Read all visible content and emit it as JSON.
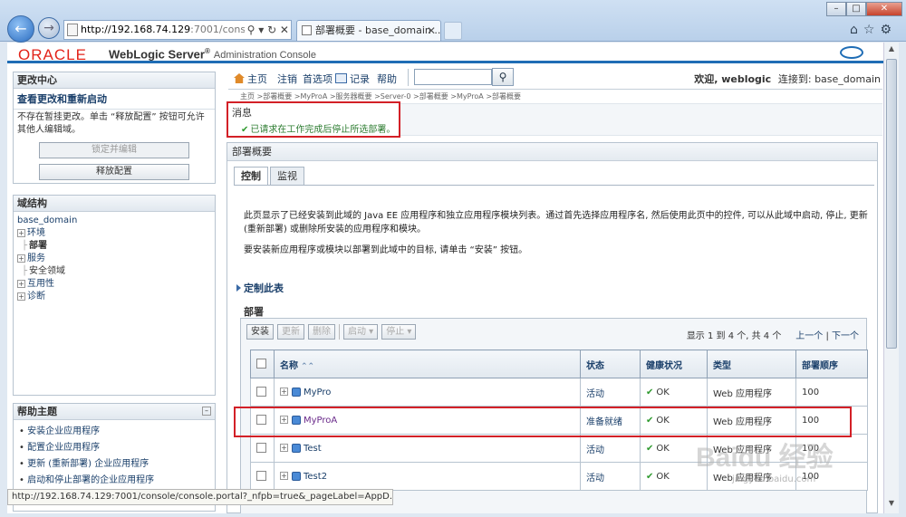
{
  "browser": {
    "url_host": "http://192.168.74.129",
    "url_rest": ":7001/console",
    "tab_title": "部署概要 - base_domain ...",
    "status_url": "http://192.168.74.129:7001/console/console.portal?_nfpb=true&_pageLabel=AppD..."
  },
  "header": {
    "logo": "ORACLE",
    "product": "WebLogic Server",
    "reg": "®",
    "subtitle": "Administration Console"
  },
  "change_center": {
    "title": "更改中心",
    "link": "查看更改和重新启动",
    "text": "不存在暂挂更改。单击 “释放配置” 按钮可允许其他人编辑域。",
    "lock_button": "锁定并编辑",
    "release_button": "释放配置"
  },
  "domain_structure": {
    "title": "域结构",
    "root": "base_domain",
    "items": [
      {
        "label": "环境",
        "expand": "+"
      },
      {
        "label": "部署",
        "expand": ""
      },
      {
        "label": "服务",
        "expand": "+"
      },
      {
        "label": "安全领域",
        "expand": ""
      },
      {
        "label": "互用性",
        "expand": "+"
      },
      {
        "label": "诊断",
        "expand": "+"
      }
    ]
  },
  "help_topics": {
    "title": "帮助主题",
    "items": [
      "安装企业应用程序",
      "配置企业应用程序",
      "更新 (重新部署) 企业应用程序",
      "启动和停止部署的企业应用程序"
    ]
  },
  "toolbar": {
    "home": "主页",
    "logout": "注销",
    "preferences": "首选项",
    "record": "记录",
    "help": "帮助",
    "welcome": "欢迎, weblogic",
    "connected": "连接到: base_domain"
  },
  "breadcrumb": "主页 >部署概要 >MyProA >服务器概要 >Server-0 >部署概要 >MyProA >部署概要",
  "message": {
    "title": "消息",
    "text": "已请求在工作完成后停止所选部署。"
  },
  "summary": {
    "title": "部署概要",
    "tabs": [
      "控制",
      "监视"
    ],
    "desc1": "此页显示了已经安装到此域的 Java EE 应用程序和独立应用程序模块列表。通过首先选择应用程序名, 然后使用此页中的控件, 可以从此域中启动, 停止, 更新 (重新部署) 或删除所安装的应用程序和模块。",
    "desc2": "要安装新应用程序或模块以部署到此域中的目标, 请单击 “安装” 按钮。",
    "customize": "定制此表",
    "deployments_title": "部署"
  },
  "dep_toolbar": {
    "install": "安装",
    "update": "更新",
    "delete": "删除",
    "start": "启动",
    "stop": "停止"
  },
  "pager": {
    "text": "显示 1 到 4 个, 共 4 个",
    "prev": "上一个",
    "sep": "|",
    "next": "下一个"
  },
  "table": {
    "headers": [
      "名称",
      "状态",
      "健康状况",
      "类型",
      "部署顺序"
    ],
    "rows": [
      {
        "name": "MyPro",
        "state": "活动",
        "health": "OK",
        "type": "Web 应用程序",
        "order": "100"
      },
      {
        "name": "MyProA",
        "state": "准备就绪",
        "health": "OK",
        "type": "Web 应用程序",
        "order": "100"
      },
      {
        "name": "Test",
        "state": "活动",
        "health": "OK",
        "type": "Web 应用程序",
        "order": "100"
      },
      {
        "name": "Test2",
        "state": "活动",
        "health": "OK",
        "type": "Web 应用程序",
        "order": "100"
      }
    ]
  },
  "watermark": {
    "brand": "Baidu 经验",
    "sub": "jingyan.baidu.com"
  },
  "colors": {
    "highlight": "#d32027",
    "accent": "#1f6db5",
    "logo": "#e2231a",
    "ok": "#2e9a2e"
  }
}
